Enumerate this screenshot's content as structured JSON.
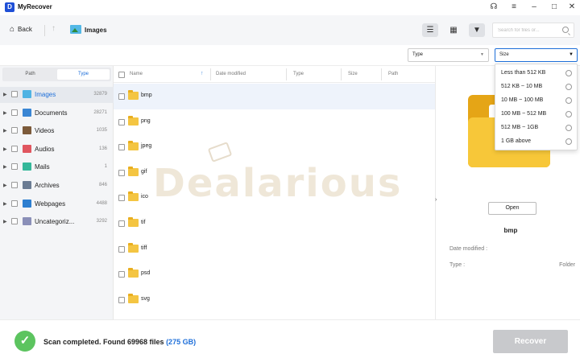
{
  "app": {
    "title": "MyRecover",
    "logo_letter": "D"
  },
  "window_controls": {
    "support_icon": "headset-icon",
    "menu_icon": "menu-icon"
  },
  "toolbar": {
    "back_label": "Back",
    "breadcrumb": "Images",
    "search_placeholder": "Search for files or..."
  },
  "filters": {
    "type_label": "Type",
    "size_label": "Size"
  },
  "size_options": [
    {
      "label": "Less than 512 KB"
    },
    {
      "label": "512 KB ~ 10 MB"
    },
    {
      "label": "10 MB ~ 100 MB"
    },
    {
      "label": "100 MB ~ 512 MB"
    },
    {
      "label": "512 MB ~ 1GB"
    },
    {
      "label": "1 GB above"
    }
  ],
  "sidebar": {
    "tabs": [
      "Path",
      "Type"
    ],
    "active_tab": "Type",
    "categories": [
      {
        "label": "Images",
        "count": "32879",
        "icon": "images-icon",
        "color": "#4fb3e3"
      },
      {
        "label": "Documents",
        "count": "28271",
        "icon": "document-icon",
        "color": "#3a86d4"
      },
      {
        "label": "Videos",
        "count": "1035",
        "icon": "video-icon",
        "color": "#7c5a3a"
      },
      {
        "label": "Audios",
        "count": "136",
        "icon": "audio-icon",
        "color": "#e0565f"
      },
      {
        "label": "Mails",
        "count": "1",
        "icon": "mail-icon",
        "color": "#35b89a"
      },
      {
        "label": "Archives",
        "count": "846",
        "icon": "archive-icon",
        "color": "#6b7c93"
      },
      {
        "label": "Webpages",
        "count": "4488",
        "icon": "webpage-icon",
        "color": "#2e7fd0"
      },
      {
        "label": "Uncategoriz...",
        "count": "3292",
        "icon": "question-icon",
        "color": "#8a8fb8"
      }
    ]
  },
  "file_list": {
    "columns": [
      "Name",
      "Date modified",
      "Type",
      "Size",
      "Path"
    ],
    "rows": [
      {
        "name": "bmp"
      },
      {
        "name": "png"
      },
      {
        "name": "jpeg"
      },
      {
        "name": "gif"
      },
      {
        "name": "ico"
      },
      {
        "name": "tif"
      },
      {
        "name": "tiff"
      },
      {
        "name": "psd"
      },
      {
        "name": "svg"
      }
    ]
  },
  "preview": {
    "open_label": "Open",
    "name": "bmp",
    "date_label": "Date modified :",
    "type_label": "Type :",
    "type_value": "Folder"
  },
  "watermark": "Dealarious",
  "status": {
    "message": "Scan completed. Found 69968 files",
    "size": "(275 GB)",
    "recover_label": "Recover"
  },
  "colors": {
    "accent": "#1e6fd9",
    "success": "#5cc45f",
    "folder": "#f4c542"
  }
}
